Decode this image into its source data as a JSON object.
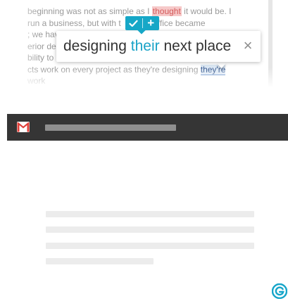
{
  "editor": {
    "lines": [
      {
        "before": "beginning was not as simple as I ",
        "mistake": "thought",
        "after": " it would be. I"
      },
      {
        "before": "run a business, but with t",
        "mistake": "",
        "after": "ffice became"
      },
      {
        "before": "; we hav",
        "mistake": "",
        "after": ""
      },
      {
        "before": "erior de",
        "mistake": "",
        "after": ""
      },
      {
        "before": "bility to",
        "mistake": "",
        "after": ""
      },
      {
        "before": "cts work on every project as they're designing ",
        "selected": "they're",
        "after": ""
      },
      {
        "before": "work",
        "mistake": "",
        "after": ""
      }
    ]
  },
  "suggestion": {
    "prefix": "designing ",
    "highlight": "their",
    "suffix": " next place",
    "close_glyph": "×",
    "plus_glyph": "+",
    "accent_color": "#16a7c7",
    "highlight_color": "#1aa3c7",
    "mistake_color": "#f6c9c9"
  },
  "mail_header": {
    "logo_icon": "gmail-icon",
    "bar_color": "#353535"
  },
  "badge": {
    "icon": "grammarly-icon",
    "color": "#15a5c9"
  }
}
